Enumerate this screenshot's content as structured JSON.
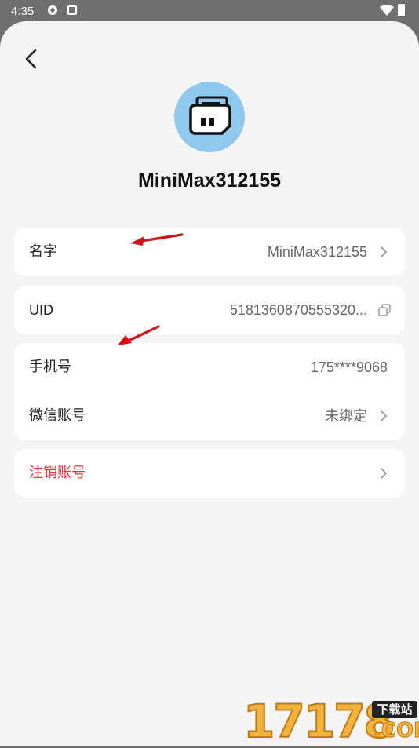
{
  "status_bar": {
    "time": "4:35"
  },
  "profile": {
    "username": "MiniMax312155"
  },
  "rows": {
    "name": {
      "label": "名字",
      "value": "MiniMax312155"
    },
    "uid": {
      "label": "UID",
      "value": "5181360870555320..."
    },
    "phone": {
      "label": "手机号",
      "value": "175****9068"
    },
    "wechat": {
      "label": "微信账号",
      "value": "未绑定"
    },
    "deactivate": {
      "label": "注销账号"
    }
  },
  "watermark": {
    "number": "17178",
    "tag": "下载站",
    "domain": ".COM"
  },
  "colors": {
    "sheet_background": "#f4f4f4",
    "card_background": "#ffffff",
    "avatar_background": "#8ec8ef",
    "danger_text": "#e8323c",
    "annotation_arrow": "#d0141a"
  }
}
